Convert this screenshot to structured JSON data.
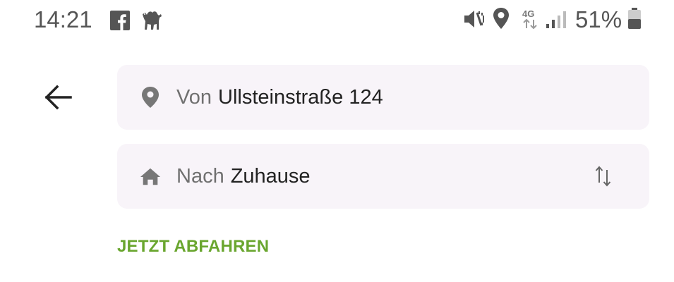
{
  "status_bar": {
    "time": "14:21",
    "battery_text": "51%",
    "network_label": "4G",
    "icons": [
      "facebook-icon",
      "camel-icon",
      "vibrate-mute-icon",
      "location-icon",
      "network-4g-icon",
      "signal-icon",
      "battery-icon"
    ]
  },
  "navigation": {
    "back_icon": "arrow-left-icon"
  },
  "from_field": {
    "prefix": "Von",
    "value": "Ullsteinstraße 124",
    "icon": "location-pin-icon"
  },
  "to_field": {
    "prefix": "Nach",
    "value": "Zuhause",
    "icon": "home-icon",
    "swap_icon": "swap-arrows-icon"
  },
  "depart_now_label": "JETZT ABFAHREN",
  "colors": {
    "accent": "#6aa62f",
    "field_background": "#f8f4f9",
    "icon_gray": "#777777",
    "text_dark": "#222222",
    "text_muted": "#707070"
  }
}
